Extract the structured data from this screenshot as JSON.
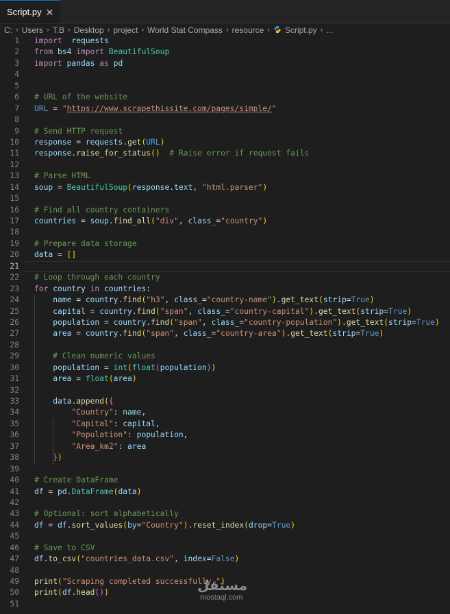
{
  "tab": {
    "label": "Script.py",
    "close": "✕"
  },
  "breadcrumb": [
    "C:",
    "Users",
    "T.B",
    "Desktop",
    "project",
    "World Stat Compass",
    "resource",
    "Script.py",
    "..."
  ],
  "lines": [
    [
      [
        "kw",
        "import"
      ],
      [
        "",
        "  "
      ],
      [
        "var",
        "requests"
      ]
    ],
    [
      [
        "kw",
        "from"
      ],
      [
        "",
        ""
      ],
      [
        "var",
        " bs4 "
      ],
      [
        "kw",
        "import"
      ],
      [
        "cl",
        " BeautifulSoup"
      ]
    ],
    [
      [
        "kw",
        "import"
      ],
      [
        "var",
        " pandas "
      ],
      [
        "kw",
        "as"
      ],
      [
        "var",
        " pd"
      ]
    ],
    [],
    [],
    [
      [
        "cm",
        "# URL of the website"
      ]
    ],
    [
      [
        "bl",
        "URL"
      ],
      [
        "",
        " = "
      ],
      [
        "str",
        "\"https://www.scrapethissite.com/pages/simple/\""
      ]
    ],
    [],
    [
      [
        "cm",
        "# Send HTTP request"
      ]
    ],
    [
      [
        "var",
        "response"
      ],
      [
        "",
        " = "
      ],
      [
        "var",
        "requests"
      ],
      [
        "",
        "."
      ],
      [
        "fn",
        "get"
      ],
      [
        "br1",
        "("
      ],
      [
        "bl",
        "URL"
      ],
      [
        "br1",
        ")"
      ]
    ],
    [
      [
        "var",
        "response"
      ],
      [
        "",
        "."
      ],
      [
        "fn",
        "raise_for_status"
      ],
      [
        "br1",
        "()"
      ],
      [
        "",
        "  "
      ],
      [
        "cm",
        "# Raise error if request fails"
      ]
    ],
    [],
    [
      [
        "cm",
        "# Parse HTML"
      ]
    ],
    [
      [
        "var",
        "soup"
      ],
      [
        "",
        " = "
      ],
      [
        "cl",
        "BeautifulSoup"
      ],
      [
        "br1",
        "("
      ],
      [
        "var",
        "response"
      ],
      [
        "",
        "."
      ],
      [
        "var",
        "text"
      ],
      [
        "",
        ", "
      ],
      [
        "str",
        "\"html.parser\""
      ],
      [
        "br1",
        ")"
      ]
    ],
    [],
    [
      [
        "cm",
        "# Find all country containers"
      ]
    ],
    [
      [
        "var",
        "countries"
      ],
      [
        "",
        " = "
      ],
      [
        "var",
        "soup"
      ],
      [
        "",
        "."
      ],
      [
        "fn",
        "find_all"
      ],
      [
        "br1",
        "("
      ],
      [
        "str",
        "\"div\""
      ],
      [
        "",
        ", "
      ],
      [
        "var",
        "class_"
      ],
      [
        "",
        "="
      ],
      [
        "str",
        "\"country\""
      ],
      [
        "br1",
        ")"
      ]
    ],
    [],
    [
      [
        "cm",
        "# Prepare data storage"
      ]
    ],
    [
      [
        "var",
        "data"
      ],
      [
        "",
        " = "
      ],
      [
        "br1",
        "[]"
      ]
    ],
    [],
    [
      [
        "cm",
        "# Loop through each country"
      ]
    ],
    [
      [
        "kw",
        "for"
      ],
      [
        "var",
        " country "
      ],
      [
        "kw",
        "in"
      ],
      [
        "var",
        " countries"
      ],
      [
        "",
        ":"
      ]
    ],
    [
      [
        "",
        "    "
      ],
      [
        "var",
        "name"
      ],
      [
        "",
        " = "
      ],
      [
        "var",
        "country"
      ],
      [
        "",
        "."
      ],
      [
        "fn",
        "find"
      ],
      [
        "br1",
        "("
      ],
      [
        "str",
        "\"h3\""
      ],
      [
        "",
        ", "
      ],
      [
        "var",
        "class_"
      ],
      [
        "",
        "="
      ],
      [
        "str",
        "\"country-name\""
      ],
      [
        "br1",
        ")"
      ],
      [
        "",
        "."
      ],
      [
        "fn",
        "get_text"
      ],
      [
        "br1",
        "("
      ],
      [
        "var",
        "strip"
      ],
      [
        "",
        "="
      ],
      [
        "bl",
        "True"
      ],
      [
        "br1",
        ")"
      ]
    ],
    [
      [
        "",
        "    "
      ],
      [
        "var",
        "capital"
      ],
      [
        "",
        " = "
      ],
      [
        "var",
        "country"
      ],
      [
        "",
        "."
      ],
      [
        "fn",
        "find"
      ],
      [
        "br1",
        "("
      ],
      [
        "str",
        "\"span\""
      ],
      [
        "",
        ", "
      ],
      [
        "var",
        "class_"
      ],
      [
        "",
        "="
      ],
      [
        "str",
        "\"country-capital\""
      ],
      [
        "br1",
        ")"
      ],
      [
        "",
        "."
      ],
      [
        "fn",
        "get_text"
      ],
      [
        "br1",
        "("
      ],
      [
        "var",
        "strip"
      ],
      [
        "",
        "="
      ],
      [
        "bl",
        "True"
      ],
      [
        "br1",
        ")"
      ]
    ],
    [
      [
        "",
        "    "
      ],
      [
        "var",
        "population"
      ],
      [
        "",
        " = "
      ],
      [
        "var",
        "country"
      ],
      [
        "",
        "."
      ],
      [
        "fn",
        "find"
      ],
      [
        "br1",
        "("
      ],
      [
        "str",
        "\"span\""
      ],
      [
        "",
        ", "
      ],
      [
        "var",
        "class_"
      ],
      [
        "",
        "="
      ],
      [
        "str",
        "\"country-population\""
      ],
      [
        "br1",
        ")"
      ],
      [
        "",
        "."
      ],
      [
        "fn",
        "get_text"
      ],
      [
        "br1",
        "("
      ],
      [
        "var",
        "strip"
      ],
      [
        "",
        "="
      ],
      [
        "bl",
        "True"
      ],
      [
        "br1",
        ")"
      ]
    ],
    [
      [
        "",
        "    "
      ],
      [
        "var",
        "area"
      ],
      [
        "",
        " = "
      ],
      [
        "var",
        "country"
      ],
      [
        "",
        "."
      ],
      [
        "fn",
        "find"
      ],
      [
        "br1",
        "("
      ],
      [
        "str",
        "\"span\""
      ],
      [
        "",
        ", "
      ],
      [
        "var",
        "class_"
      ],
      [
        "",
        "="
      ],
      [
        "str",
        "\"country-area\""
      ],
      [
        "br1",
        ")"
      ],
      [
        "",
        "."
      ],
      [
        "fn",
        "get_text"
      ],
      [
        "br1",
        "("
      ],
      [
        "var",
        "strip"
      ],
      [
        "",
        "="
      ],
      [
        "bl",
        "True"
      ],
      [
        "br1",
        ")"
      ]
    ],
    [],
    [
      [
        "",
        "    "
      ],
      [
        "cm",
        "# Clean numeric values"
      ]
    ],
    [
      [
        "",
        "    "
      ],
      [
        "var",
        "population"
      ],
      [
        "",
        " = "
      ],
      [
        "cl",
        "int"
      ],
      [
        "br1",
        "("
      ],
      [
        "cl",
        "float"
      ],
      [
        "br2",
        "("
      ],
      [
        "var",
        "population"
      ],
      [
        "br2",
        ")"
      ],
      [
        "br1",
        ")"
      ]
    ],
    [
      [
        "",
        "    "
      ],
      [
        "var",
        "area"
      ],
      [
        "",
        " = "
      ],
      [
        "cl",
        "float"
      ],
      [
        "br1",
        "("
      ],
      [
        "var",
        "area"
      ],
      [
        "br1",
        ")"
      ]
    ],
    [],
    [
      [
        "",
        "    "
      ],
      [
        "var",
        "data"
      ],
      [
        "",
        "."
      ],
      [
        "fn",
        "append"
      ],
      [
        "br1",
        "("
      ],
      [
        "br2",
        "{"
      ]
    ],
    [
      [
        "",
        "        "
      ],
      [
        "str",
        "\"Country\""
      ],
      [
        "",
        ": "
      ],
      [
        "var",
        "name"
      ],
      [
        "",
        ","
      ]
    ],
    [
      [
        "",
        "        "
      ],
      [
        "str",
        "\"Capital\""
      ],
      [
        "",
        ": "
      ],
      [
        "var",
        "capital"
      ],
      [
        "",
        ","
      ]
    ],
    [
      [
        "",
        "        "
      ],
      [
        "str",
        "\"Population\""
      ],
      [
        "",
        ": "
      ],
      [
        "var",
        "population"
      ],
      [
        "",
        ","
      ]
    ],
    [
      [
        "",
        "        "
      ],
      [
        "str",
        "\"Area_km2\""
      ],
      [
        "",
        ": "
      ],
      [
        "var",
        "area"
      ]
    ],
    [
      [
        "",
        "    "
      ],
      [
        "br2",
        "}"
      ],
      [
        "br1",
        ")"
      ]
    ],
    [],
    [
      [
        "cm",
        "# Create DataFrame"
      ]
    ],
    [
      [
        "var",
        "df"
      ],
      [
        "",
        " = "
      ],
      [
        "var",
        "pd"
      ],
      [
        "",
        "."
      ],
      [
        "cl",
        "DataFrame"
      ],
      [
        "br1",
        "("
      ],
      [
        "var",
        "data"
      ],
      [
        "br1",
        ")"
      ]
    ],
    [],
    [
      [
        "cm",
        "# Optional: sort alphabetically"
      ]
    ],
    [
      [
        "var",
        "df"
      ],
      [
        "",
        " = "
      ],
      [
        "var",
        "df"
      ],
      [
        "",
        "."
      ],
      [
        "fn",
        "sort_values"
      ],
      [
        "br1",
        "("
      ],
      [
        "var",
        "by"
      ],
      [
        "",
        "="
      ],
      [
        "str",
        "\"Country\""
      ],
      [
        "br1",
        ")"
      ],
      [
        "",
        "."
      ],
      [
        "fn",
        "reset_index"
      ],
      [
        "br1",
        "("
      ],
      [
        "var",
        "drop"
      ],
      [
        "",
        "="
      ],
      [
        "bl",
        "True"
      ],
      [
        "br1",
        ")"
      ]
    ],
    [],
    [
      [
        "cm",
        "# Save to CSV"
      ]
    ],
    [
      [
        "var",
        "df"
      ],
      [
        "",
        "."
      ],
      [
        "fn",
        "to_csv"
      ],
      [
        "br1",
        "("
      ],
      [
        "str",
        "\"countries_data.csv\""
      ],
      [
        "",
        ", "
      ],
      [
        "var",
        "index"
      ],
      [
        "",
        "="
      ],
      [
        "bl",
        "False"
      ],
      [
        "br1",
        ")"
      ]
    ],
    [],
    [
      [
        "fn",
        "print"
      ],
      [
        "br1",
        "("
      ],
      [
        "str",
        "\"Scraping completed successfully.\""
      ],
      [
        "br1",
        ")"
      ]
    ],
    [
      [
        "fn",
        "print"
      ],
      [
        "br1",
        "("
      ],
      [
        "var",
        "df"
      ],
      [
        "",
        "."
      ],
      [
        "fn",
        "head"
      ],
      [
        "br2",
        "()"
      ],
      [
        "br1",
        ")"
      ]
    ],
    []
  ],
  "watermark": {
    "main": "مستقل",
    "sub": "mostaql.com"
  }
}
